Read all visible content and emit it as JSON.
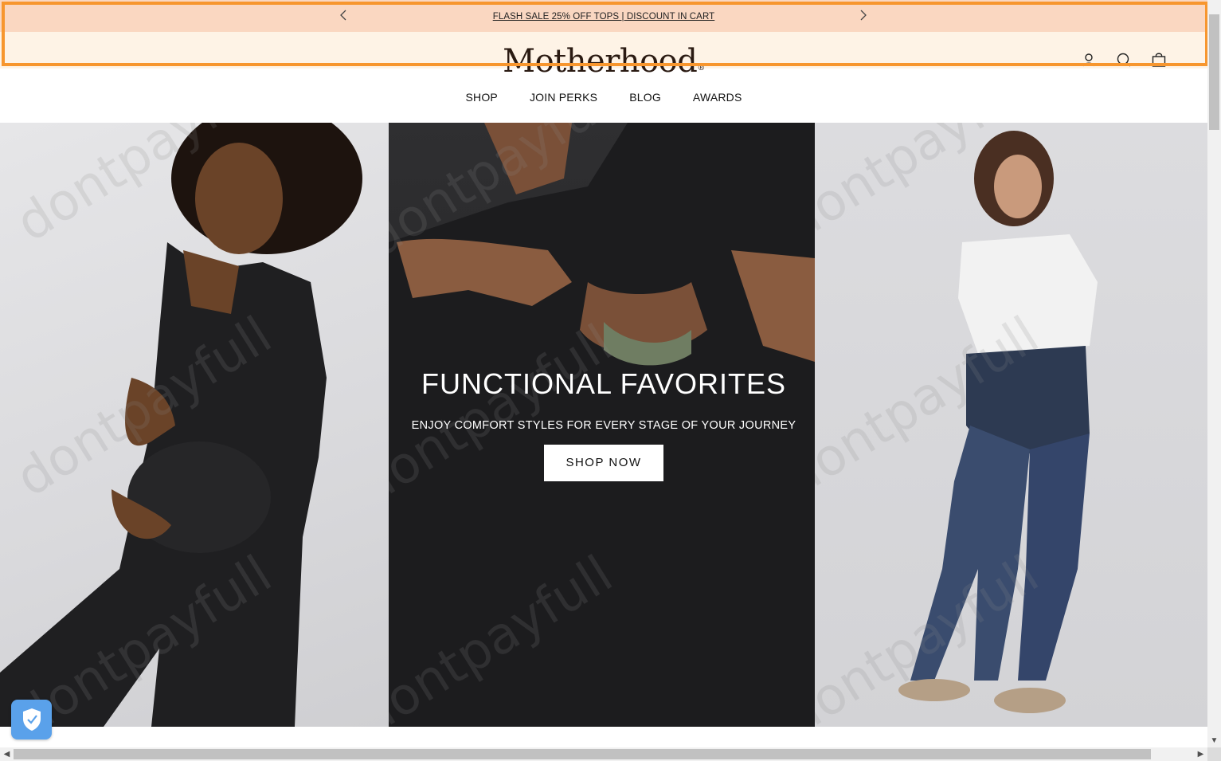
{
  "announcement": {
    "text": "FLASH SALE 25% OFF TOPS | DISCOUNT IN CART",
    "prev_icon": "chevron-left-icon",
    "next_icon": "chevron-right-icon"
  },
  "header": {
    "logo": "Motherhood",
    "logo_mark": "®",
    "icons": [
      "account-icon",
      "search-icon",
      "shopping-bag-icon"
    ]
  },
  "nav": {
    "items": [
      {
        "label": "SHOP"
      },
      {
        "label": "JOIN PERKS"
      },
      {
        "label": "BLOG"
      },
      {
        "label": "AWARDS"
      }
    ]
  },
  "hero": {
    "title": "FUNCTIONAL FAVORITES",
    "subtitle": "ENJOY COMFORT STYLES FOR EVERY STAGE OF YOUR JOURNEY",
    "cta": "SHOP NOW"
  },
  "watermark": "dontpayfull",
  "colors": {
    "announcement_bg": "#fad7c1",
    "focus_outline": "#f7962e",
    "header_tint": "#fef3e6",
    "badge_bg": "#5aa1ea"
  },
  "widgets": {
    "shield_icon": "shield-check-icon"
  }
}
